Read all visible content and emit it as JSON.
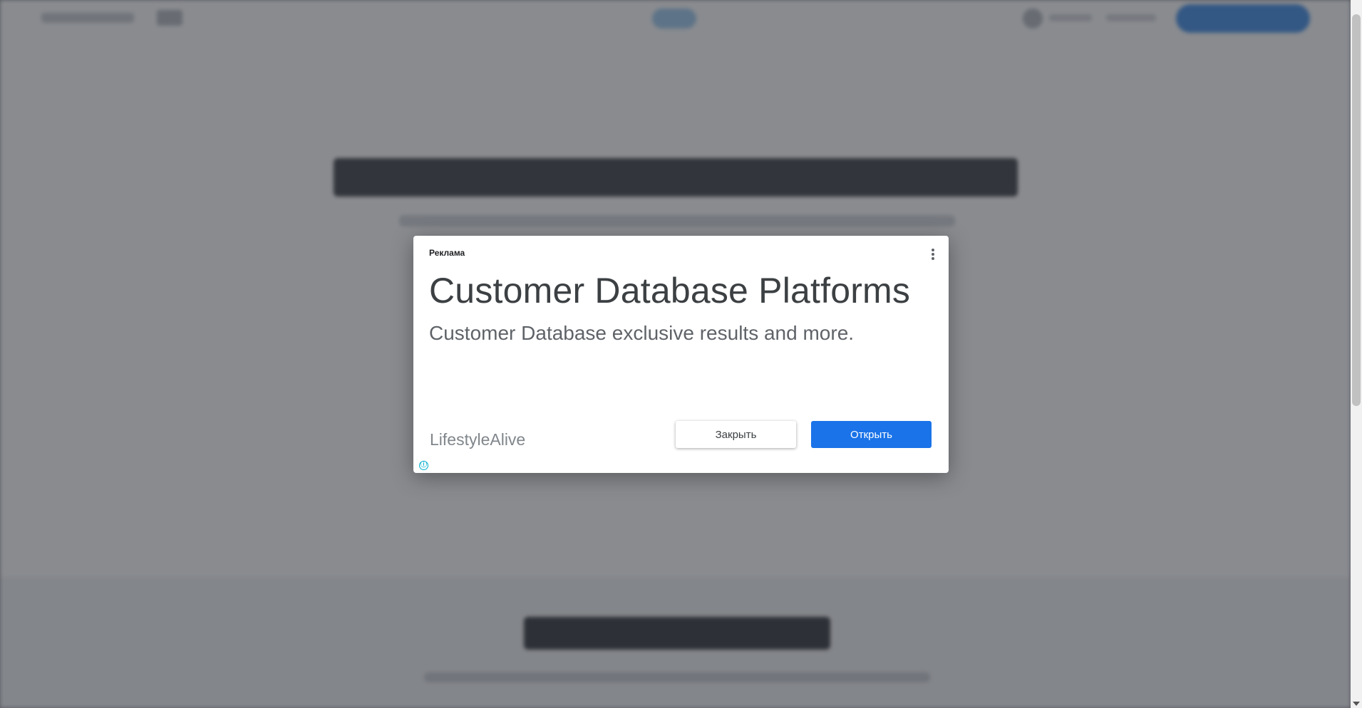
{
  "ad": {
    "label": "Реклама",
    "title": "Customer Database Platforms",
    "description": "Customer Database exclusive results and more.",
    "advertiser": "LifestyleAlive",
    "close_label": "Закрыть",
    "open_label": "Открыть",
    "info_icon": "ⓘ",
    "menu_icon": "more-vert-icon"
  },
  "colors": {
    "primary_button": "#1a73e8",
    "overlay": "rgba(44,48,56,0.56)",
    "info_icon": "#00aecd"
  }
}
